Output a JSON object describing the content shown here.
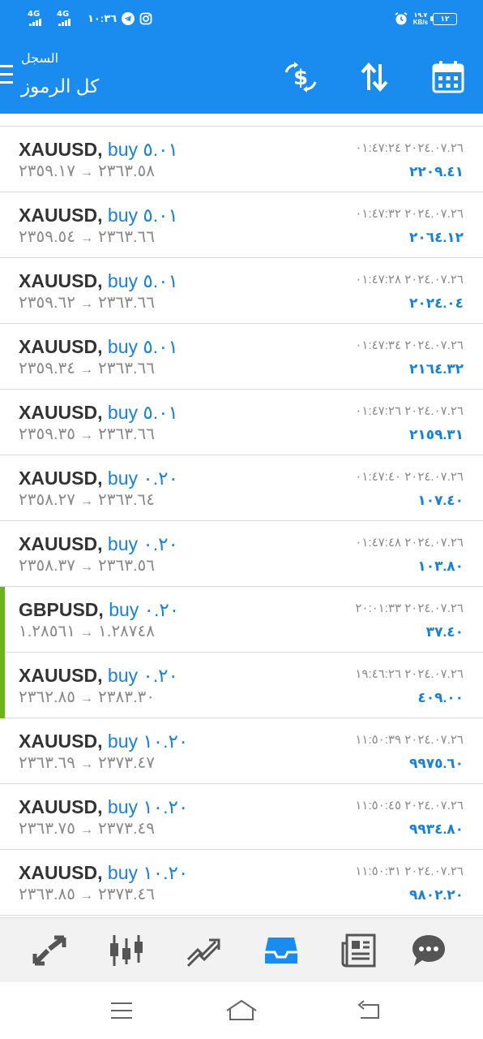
{
  "status_bar": {
    "network_1": "4G",
    "network_2": "4G",
    "time": "١٠:٣٦",
    "net_speed_value": "١٩.٧",
    "net_speed_unit": "KB/s",
    "battery": "١٢"
  },
  "app_bar": {
    "subtitle": "السجل",
    "title": "كل الرموز",
    "actions": [
      "currency-exchange-icon",
      "sort-icon",
      "calendar-icon"
    ]
  },
  "colors": {
    "primary": "#1a8cf0",
    "buy_text": "#1a82d6",
    "profit_text": "#1a82d6",
    "muted_text": "#8a8a8a",
    "row_marker": "#6db31e",
    "active_nav": "#1a8cf0",
    "inactive_nav": "#555555"
  },
  "deals": [
    {
      "symbol": "XAUUSD,",
      "side": "buy",
      "volume": "٥.٠١",
      "open_price": "٢٣٥٩.١٧",
      "close_price": "٢٣٦٣.٥٨",
      "time": "٢٠٢٤.٠٧.٢٦ ٠١:٤٧:٢٤",
      "profit": "٢٢٠٩.٤١",
      "marked": false
    },
    {
      "symbol": "XAUUSD,",
      "side": "buy",
      "volume": "٥.٠١",
      "open_price": "٢٣٥٩.٥٤",
      "close_price": "٢٣٦٣.٦٦",
      "time": "٢٠٢٤.٠٧.٢٦ ٠١:٤٧:٣٢",
      "profit": "٢٠٦٤.١٢",
      "marked": false
    },
    {
      "symbol": "XAUUSD,",
      "side": "buy",
      "volume": "٥.٠١",
      "open_price": "٢٣٥٩.٦٢",
      "close_price": "٢٣٦٣.٦٦",
      "time": "٢٠٢٤.٠٧.٢٦ ٠١:٤٧:٢٨",
      "profit": "٢٠٢٤.٠٤",
      "marked": false
    },
    {
      "symbol": "XAUUSD,",
      "side": "buy",
      "volume": "٥.٠١",
      "open_price": "٢٣٥٩.٣٤",
      "close_price": "٢٣٦٣.٦٦",
      "time": "٢٠٢٤.٠٧.٢٦ ٠١:٤٧:٣٤",
      "profit": "٢١٦٤.٣٢",
      "marked": false
    },
    {
      "symbol": "XAUUSD,",
      "side": "buy",
      "volume": "٥.٠١",
      "open_price": "٢٣٥٩.٣٥",
      "close_price": "٢٣٦٣.٦٦",
      "time": "٢٠٢٤.٠٧.٢٦ ٠١:٤٧:٢٦",
      "profit": "٢١٥٩.٣١",
      "marked": false
    },
    {
      "symbol": "XAUUSD,",
      "side": "buy",
      "volume": "٠.٢٠",
      "open_price": "٢٣٥٨.٢٧",
      "close_price": "٢٣٦٣.٦٤",
      "time": "٢٠٢٤.٠٧.٢٦ ٠١:٤٧:٤٠",
      "profit": "١٠٧.٤٠",
      "marked": false
    },
    {
      "symbol": "XAUUSD,",
      "side": "buy",
      "volume": "٠.٢٠",
      "open_price": "٢٣٥٨.٣٧",
      "close_price": "٢٣٦٣.٥٦",
      "time": "٢٠٢٤.٠٧.٢٦ ٠١:٤٧:٤٨",
      "profit": "١٠٣.٨٠",
      "marked": false
    },
    {
      "symbol": "GBPUSD,",
      "side": "buy",
      "volume": "٠.٢٠",
      "open_price": "١.٢٨٥٦١",
      "close_price": "١.٢٨٧٤٨",
      "time": "٢٠٢٤.٠٧.٢٦ ٢٠:٠١:٣٣",
      "profit": "٣٧.٤٠",
      "marked": true
    },
    {
      "symbol": "XAUUSD,",
      "side": "buy",
      "volume": "٠.٢٠",
      "open_price": "٢٣٦٢.٨٥",
      "close_price": "٢٣٨٣.٣٠",
      "time": "٢٠٢٤.٠٧.٢٦ ١٩:٤٦:٢٦",
      "profit": "٤٠٩.٠٠",
      "marked": true
    },
    {
      "symbol": "XAUUSD,",
      "side": "buy",
      "volume": "١٠.٢٠",
      "open_price": "٢٣٦٣.٦٩",
      "close_price": "٢٣٧٣.٤٧",
      "time": "٢٠٢٤.٠٧.٢٦ ١١:٥٠:٣٩",
      "profit": "٩٩٧٥.٦٠",
      "marked": false
    },
    {
      "symbol": "XAUUSD,",
      "side": "buy",
      "volume": "١٠.٢٠",
      "open_price": "٢٣٦٣.٧٥",
      "close_price": "٢٣٧٣.٤٩",
      "time": "٢٠٢٤.٠٧.٢٦ ١١:٥٠:٤٥",
      "profit": "٩٩٣٤.٨٠",
      "marked": false
    },
    {
      "symbol": "XAUUSD,",
      "side": "buy",
      "volume": "١٠.٢٠",
      "open_price": "٢٣٦٣.٨٥",
      "close_price": "٢٣٧٣.٤٦",
      "time": "٢٠٢٤.٠٧.٢٦ ١١:٥٠:٣١",
      "profit": "٩٨٠٢.٢٠",
      "marked": false
    }
  ],
  "bottom_nav": {
    "items": [
      "quotes-icon",
      "chart-icon",
      "trade-icon",
      "history-icon",
      "news-icon",
      "chat-icon"
    ],
    "active": "history-icon"
  },
  "system_nav": [
    "recents-icon",
    "home-icon",
    "back-icon"
  ]
}
